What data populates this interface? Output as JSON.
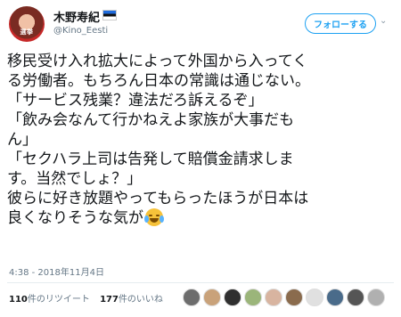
{
  "header": {
    "avatar_label": "選挙",
    "name": "木野寿紀",
    "handle": "@Kino_Eesti",
    "follow_label": "フォローする",
    "chevron_glyph": "⌄"
  },
  "tweet": {
    "lines": [
      "移民受け入れ拡大によって外国から入ってく",
      "る労働者。もちろん日本の常識は通じない。",
      "「サービス残業？違法だろ訴えるぞ」",
      "「飲み会なんて行かねえよ家族が大事だも",
      "ん」",
      "「セクハラ上司は告発して賠償金請求しま",
      "す。当然でしょ？」",
      "彼らに好き放題やってもらったほうが日本は",
      "良くなりそうな気が"
    ],
    "trailing_emoji": "face-with-tears-of-joy"
  },
  "timestamp": "4:38 - 2018年11月4日",
  "stats": {
    "retweets_count": "110",
    "retweets_label": "件のリツイート",
    "likes_count": "177",
    "likes_label": "件のいいね"
  },
  "colors": {
    "accent": "#1da1f2",
    "muted": "#657786",
    "text": "#14171a"
  },
  "likers": [
    "#6d6d6d",
    "#c9a27a",
    "#2f2f2f",
    "#9bb57a",
    "#d8b4a0",
    "#8a6b4d",
    "#e0e0e0",
    "#4a6b8a",
    "#555555",
    "#b0b0b0"
  ]
}
